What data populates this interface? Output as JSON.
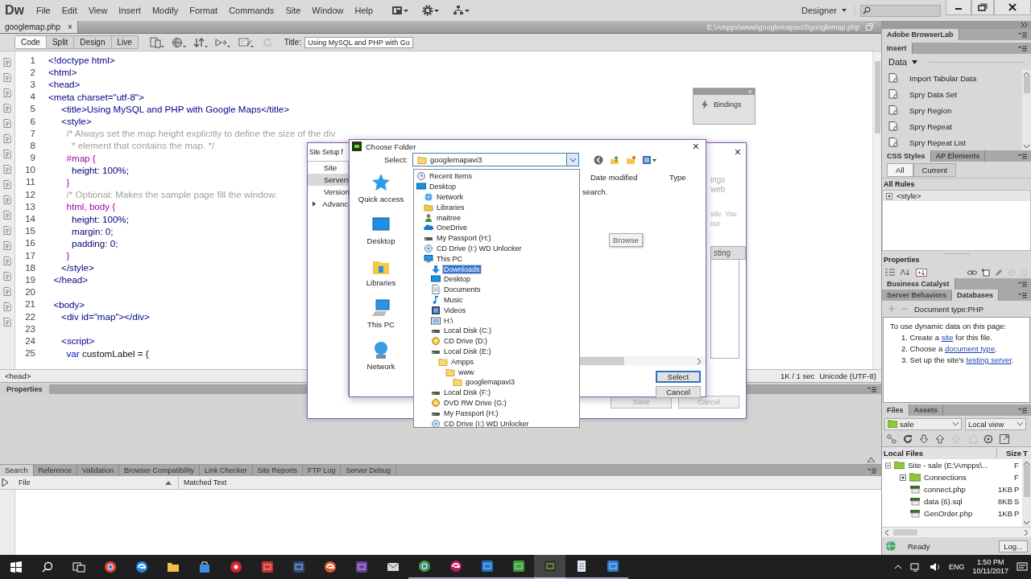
{
  "menubar": {
    "logo": "Dw",
    "menus": [
      "File",
      "Edit",
      "View",
      "Insert",
      "Modify",
      "Format",
      "Commands",
      "Site",
      "Window",
      "Help"
    ],
    "workspace": "Designer"
  },
  "document": {
    "tab": {
      "label": "googlemap.php",
      "close": "×"
    },
    "path": "E:\\Ampps\\www\\googlemapavi3\\googlemap.php"
  },
  "toolbar": {
    "views": [
      {
        "label": "Code",
        "selected": true
      },
      {
        "label": "Split",
        "selected": false
      },
      {
        "label": "Design",
        "selected": false
      },
      {
        "label": "Live",
        "selected": false
      }
    ],
    "title_label": "Title:",
    "title_value": "Using MySQL and PHP with Go"
  },
  "code": {
    "lines": [
      {
        "number": "1",
        "segments": [
          {
            "kind": "tag",
            "text": "<!doctype html>"
          }
        ]
      },
      {
        "number": "2",
        "segments": [
          {
            "kind": "tag",
            "text": "<html>"
          }
        ]
      },
      {
        "number": "3",
        "segments": [
          {
            "kind": "tag",
            "text": "<head>"
          }
        ]
      },
      {
        "number": "4",
        "segments": [
          {
            "kind": "tag",
            "text": "<meta charset=\"utf-8\">"
          }
        ]
      },
      {
        "number": "5",
        "segments": [
          {
            "kind": "tag",
            "text": "     <title>Using MySQL and PHP with Google Maps</title>"
          }
        ]
      },
      {
        "number": "6",
        "segments": [
          {
            "kind": "tag",
            "text": "     <style>"
          }
        ]
      },
      {
        "number": "7",
        "segments": [
          {
            "kind": "comment",
            "text": "       /* Always set the map height explicitly to define the size of the div"
          }
        ]
      },
      {
        "number": "8",
        "segments": [
          {
            "kind": "comment",
            "text": "         * element that contains the map. */"
          }
        ]
      },
      {
        "number": "9",
        "segments": [
          {
            "kind": "selector",
            "text": "       #map {"
          }
        ]
      },
      {
        "number": "10",
        "segments": [
          {
            "kind": "property",
            "text": "         height: 100%;"
          }
        ]
      },
      {
        "number": "11",
        "segments": [
          {
            "kind": "selector",
            "text": "       }"
          }
        ]
      },
      {
        "number": "12",
        "segments": [
          {
            "kind": "comment",
            "text": "       /* Optional: Makes the sample page fill the window."
          }
        ]
      },
      {
        "number": "13",
        "segments": [
          {
            "kind": "selector",
            "text": "       html, body {"
          }
        ]
      },
      {
        "number": "14",
        "segments": [
          {
            "kind": "property",
            "text": "         height: 100%;"
          }
        ]
      },
      {
        "number": "15",
        "segments": [
          {
            "kind": "property",
            "text": "         margin: 0;"
          }
        ]
      },
      {
        "number": "16",
        "segments": [
          {
            "kind": "property",
            "text": "         padding: 0;"
          }
        ]
      },
      {
        "number": "17",
        "segments": [
          {
            "kind": "selector",
            "text": "       }"
          }
        ]
      },
      {
        "number": "18",
        "segments": [
          {
            "kind": "tag",
            "text": "     </style>"
          }
        ]
      },
      {
        "number": "19",
        "segments": [
          {
            "kind": "tag",
            "text": "  </head>"
          }
        ]
      },
      {
        "number": "20"
      },
      {
        "number": "21",
        "segments": [
          {
            "kind": "tag",
            "text": "  <body>"
          }
        ]
      },
      {
        "number": "22",
        "segments": [
          {
            "kind": "tag",
            "text": "     <div id=\"map\"></div>"
          }
        ]
      },
      {
        "number": "23"
      },
      {
        "number": "24",
        "segments": [
          {
            "kind": "tag",
            "text": "     <script>"
          }
        ]
      },
      {
        "number": "25",
        "segments": [
          {
            "kind": "keyword",
            "text": "       var"
          },
          {
            "kind": "plain",
            "text": " customLabel = {"
          }
        ]
      }
    ]
  },
  "bindings_panel": {
    "label": "Bindings"
  },
  "status_bar": {
    "tag": "<head>",
    "size": "1K / 1 sec",
    "encoding": "Unicode (UTF-8)"
  },
  "properties_panel": {
    "title": "Properties"
  },
  "results": {
    "tabs": [
      {
        "label": "Search",
        "selected": true
      },
      {
        "label": "Reference",
        "selected": false
      },
      {
        "label": "Validation",
        "selected": false
      },
      {
        "label": "Browser Compatibility",
        "selected": false
      },
      {
        "label": "Link Checker",
        "selected": false
      },
      {
        "label": "Site Reports",
        "selected": false
      },
      {
        "label": "FTP Log",
        "selected": false
      },
      {
        "label": "Server Debug",
        "selected": false
      }
    ],
    "columns": [
      "File",
      "Matched Text"
    ]
  },
  "site_setup": {
    "title": "Site Setup f",
    "close": "×",
    "nav": [
      {
        "label": "Site",
        "selected": false
      },
      {
        "label": "Servers",
        "selected": true
      },
      {
        "label": "Version",
        "selected": false
      },
      {
        "label": "Advanc",
        "selected": false
      }
    ],
    "fragments": [
      "ings",
      "web"
    ],
    "notes": [
      "site. You",
      "our"
    ],
    "tab": "sting",
    "buttons": [
      {
        "label": "Save",
        "disabled": true
      },
      {
        "label": "Cancel",
        "disabled": true
      }
    ]
  },
  "choose_folder": {
    "title": "Choose Folder",
    "close": "×",
    "select_label": "Select:",
    "select_value": "googlemapavi3",
    "places": [
      {
        "kind": "star",
        "label": "Quick access"
      },
      {
        "kind": "desktop",
        "label": "Desktop"
      },
      {
        "kind": "libraries",
        "label": "Libraries"
      },
      {
        "kind": "pc",
        "label": "This PC"
      },
      {
        "kind": "network",
        "label": "Network"
      }
    ],
    "columns": [
      "Date modified",
      "Type"
    ],
    "message": "search.",
    "browse": "Browse",
    "buttons": [
      {
        "label": "Select",
        "focused": true
      },
      {
        "label": "Cancel",
        "focused": false
      }
    ],
    "dropdown": [
      {
        "label": "Recent Items",
        "kind": "recent",
        "selected": false
      },
      {
        "label": "Desktop",
        "kind": "desktop",
        "selected": false,
        "children": [
          {
            "label": "Network",
            "kind": "network",
            "selected": false
          },
          {
            "label": "Libraries",
            "kind": "libraries",
            "selected": false
          },
          {
            "label": "maitree",
            "kind": "user",
            "selected": false
          },
          {
            "label": "OneDrive",
            "kind": "cloud",
            "selected": false
          },
          {
            "label": "My Passport (H:)",
            "kind": "drive",
            "selected": false
          },
          {
            "label": "CD Drive (I:) WD Unlocker",
            "kind": "cd",
            "selected": false
          },
          {
            "label": "This PC",
            "kind": "pc",
            "selected": false,
            "children": [
              {
                "label": "Downloads",
                "kind": "download",
                "selected": true
              },
              {
                "label": "Desktop",
                "kind": "desktop",
                "selected": false
              },
              {
                "label": "Documents",
                "kind": "document",
                "selected": false
              },
              {
                "label": "Music",
                "kind": "music",
                "selected": false
              },
              {
                "label": "Videos",
                "kind": "video",
                "selected": false
              },
              {
                "label": "H:\\",
                "kind": "image",
                "selected": false
              },
              {
                "label": "Local Disk (C:)",
                "kind": "drive",
                "selected": false
              },
              {
                "label": "CD Drive (D:)",
                "kind": "disc",
                "selected": false
              },
              {
                "label": "Local Disk (E:)",
                "kind": "drive",
                "selected": false,
                "children": [
                  {
                    "label": "Ampps",
                    "kind": "folder",
                    "selected": false,
                    "children": [
                      {
                        "label": "www",
                        "kind": "folder",
                        "selected": false,
                        "children": [
                          {
                            "label": "googlemapavi3",
                            "kind": "folder",
                            "selected": false
                          }
                        ]
                      }
                    ]
                  }
                ]
              },
              {
                "label": "Local Disk (F:)",
                "kind": "drive",
                "selected": false
              },
              {
                "label": "DVD RW Drive (G:)",
                "kind": "disc",
                "selected": false
              },
              {
                "label": "My Passport (H:)",
                "kind": "drive",
                "selected": false
              },
              {
                "label": "CD Drive (I:) WD Unlocker",
                "kind": "cd",
                "selected": false
              }
            ]
          }
        ]
      }
    ]
  },
  "right_panel": {
    "browserlab": "Adobe BrowserLab",
    "insert": {
      "title": "Insert",
      "category": "Data",
      "items": [
        "Import Tabular Data",
        "Spry Data Set",
        "Spry Region",
        "Spry Repeat",
        "Spry Repeat List"
      ]
    },
    "css": {
      "tabs": [
        {
          "label": "CSS Styles",
          "selected": true
        },
        {
          "label": "AP Elements",
          "selected": false
        }
      ],
      "modes": [
        {
          "label": "All",
          "selected": true
        },
        {
          "label": "Current",
          "selected": false
        }
      ],
      "header": "All Rules",
      "rules": [
        {
          "label": "<style>",
          "expanded": false
        }
      ]
    },
    "properties": "Properties",
    "business_catalyst": "Business Catalyst",
    "server": {
      "tabs": [
        {
          "label": "Server Behaviors",
          "selected": false
        },
        {
          "label": "Databases",
          "selected": true
        }
      ],
      "doc_type": "Document type:PHP",
      "intro": "To use dynamic data on this page:",
      "steps": [
        {
          "before": "1. Create a ",
          "link": "site",
          "after": " for this file."
        },
        {
          "before": "2. Choose a ",
          "link": "document type",
          "after": "."
        },
        {
          "before": "3. Set up the site's ",
          "link": "testing server",
          "after": "."
        }
      ]
    },
    "files": {
      "tabs": [
        {
          "label": "Files",
          "selected": true
        },
        {
          "label": "Assets",
          "selected": false
        }
      ],
      "site": "sale",
      "view": "Local view",
      "columns": [
        "Local Files",
        "Size",
        "T"
      ],
      "tree": [
        {
          "label": "Site - sale (E:\\Ampps\\...",
          "type": "F",
          "kind": "site",
          "expanded": true,
          "children": [
            {
              "label": "Connections",
              "type": "F",
              "kind": "folder",
              "expanded": false
            },
            {
              "label": "connect.php",
              "size": "1KB",
              "type": "P",
              "kind": "file"
            },
            {
              "label": "data (6).sql",
              "size": "8KB",
              "type": "S",
              "kind": "file"
            },
            {
              "label": "GenOrder.php",
              "size": "1KB",
              "type": "P",
              "kind": "file"
            }
          ]
        }
      ],
      "status": "Ready",
      "log": "Log..."
    }
  },
  "taskbar": {
    "apps": [
      {
        "kind": "ring",
        "color": "#e8453c",
        "open": false,
        "selected": false
      },
      {
        "kind": "swirl",
        "color": "#1e88e5",
        "open": false,
        "selected": false
      },
      {
        "kind": "folder",
        "color": "#f0c24a",
        "open": false,
        "selected": false
      },
      {
        "kind": "bag",
        "color": "#3b8fe0",
        "open": false,
        "selected": false
      },
      {
        "kind": "disc",
        "color": "#d9262b",
        "open": false,
        "selected": false
      },
      {
        "kind": "tile",
        "color": "#c9302c",
        "open": false,
        "selected": false
      },
      {
        "kind": "tile",
        "color": "#2b4a7a",
        "open": false,
        "selected": false
      },
      {
        "kind": "swirl",
        "color": "#e05a2a",
        "open": false,
        "selected": false
      },
      {
        "kind": "tile",
        "color": "#6a3fa0",
        "open": false,
        "selected": false
      },
      {
        "kind": "envelope",
        "color": "#d8d8d8",
        "open": false,
        "selected": false
      },
      {
        "kind": "ring",
        "color": "#43a047",
        "open": true,
        "selected": false
      },
      {
        "kind": "swirl",
        "color": "#c2185b",
        "open": true,
        "selected": false
      },
      {
        "kind": "tile",
        "color": "#1e6fc8",
        "open": true,
        "selected": false
      },
      {
        "kind": "tile",
        "color": "#3c9a3c",
        "open": true,
        "selected": false
      },
      {
        "kind": "tile",
        "color": "#2d3a1e",
        "open": true,
        "selected": true
      },
      {
        "kind": "page",
        "color": "#e8e8e8",
        "open": true,
        "selected": false
      },
      {
        "kind": "tile",
        "color": "#2e7bd1",
        "open": true,
        "selected": false
      }
    ],
    "language": "ENG",
    "time": "1:50 PM",
    "date": "10/11/2017"
  }
}
